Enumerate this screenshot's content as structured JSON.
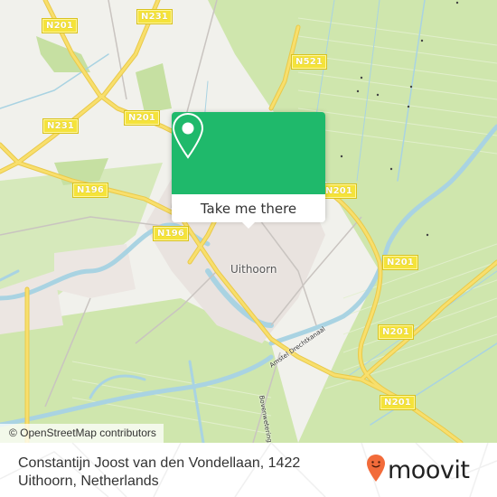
{
  "map": {
    "place_label": "Uithoorn",
    "road_labels": [
      {
        "id": "n201-nw",
        "text": "N201"
      },
      {
        "id": "n231-n",
        "text": "N231"
      },
      {
        "id": "n201-mid",
        "text": "N201"
      },
      {
        "id": "n231-w",
        "text": "N231"
      },
      {
        "id": "n196",
        "text": "N196"
      },
      {
        "id": "n521",
        "text": "N521"
      },
      {
        "id": "n201-ne",
        "text": "N201"
      },
      {
        "id": "n19x",
        "text": "N196"
      },
      {
        "id": "n201-e1",
        "text": "N201"
      },
      {
        "id": "n201-e2",
        "text": "N201"
      },
      {
        "id": "n201-se",
        "text": "N201"
      }
    ],
    "street_labels": {
      "canal": "Amstel Drechtkanaal",
      "wetering": "Bovenwetering"
    },
    "attribution": "© OpenStreetMap contributors",
    "colors": {
      "land": "#eef0ea",
      "green": "#cfe7b0",
      "water": "#aad3df",
      "road": "#f7d955",
      "urban": "#e8e2e0"
    }
  },
  "popup": {
    "icon": "location-pin-icon",
    "button_label": "Take me there",
    "accent": "#1fb96b"
  },
  "footer": {
    "address_line1": "Constantijn Joost van den Vondellaan, 1422",
    "address_line2": "Uithoorn, Netherlands",
    "brand": "moovit",
    "brand_color": "#f26b3a"
  }
}
